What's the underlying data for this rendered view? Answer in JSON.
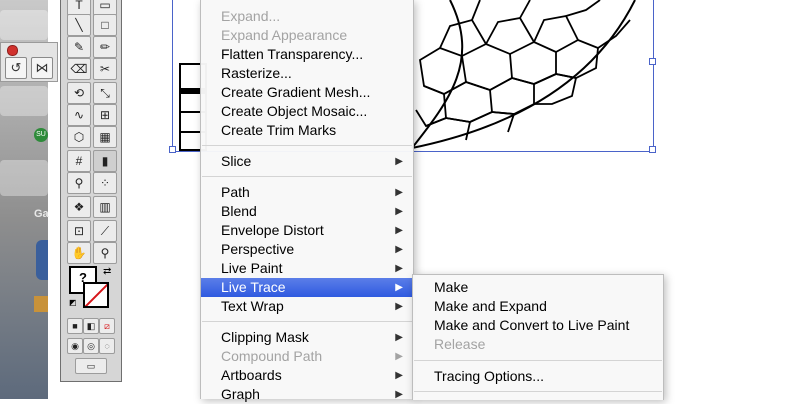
{
  "menu": {
    "items": [
      {
        "label": "Expand...",
        "disabled": true
      },
      {
        "label": "Expand Appearance",
        "disabled": true
      },
      {
        "label": "Flatten Transparency..."
      },
      {
        "label": "Rasterize..."
      },
      {
        "label": "Create Gradient Mesh..."
      },
      {
        "label": "Create Object Mosaic..."
      },
      {
        "label": "Create Trim Marks"
      },
      {
        "label": "Slice",
        "submenu": true
      },
      {
        "label": "Path",
        "submenu": true
      },
      {
        "label": "Blend",
        "submenu": true
      },
      {
        "label": "Envelope Distort",
        "submenu": true
      },
      {
        "label": "Perspective",
        "submenu": true
      },
      {
        "label": "Live Paint",
        "submenu": true
      },
      {
        "label": "Live Trace",
        "submenu": true,
        "active": true
      },
      {
        "label": "Text Wrap",
        "submenu": true
      },
      {
        "label": "Clipping Mask",
        "submenu": true
      },
      {
        "label": "Compound Path",
        "submenu": true,
        "disabled": true
      },
      {
        "label": "Artboards",
        "submenu": true
      },
      {
        "label": "Graph",
        "submenu": true
      }
    ],
    "arrow_glyph": "▶"
  },
  "submenu": {
    "items": [
      {
        "label": "Make"
      },
      {
        "label": "Make and Expand"
      },
      {
        "label": "Make and Convert to Live Paint"
      },
      {
        "label": "Release",
        "disabled": true
      },
      {
        "label": "Tracing Options..."
      }
    ]
  },
  "desktop": {
    "partial_label": "Ga",
    "badge_text": "SU"
  },
  "tools_panel": {
    "fill_indicator": "?"
  },
  "colors": {
    "highlight": "#2f5ae0",
    "selection": "#4a63c9",
    "none_stroke": "#d6161a"
  }
}
